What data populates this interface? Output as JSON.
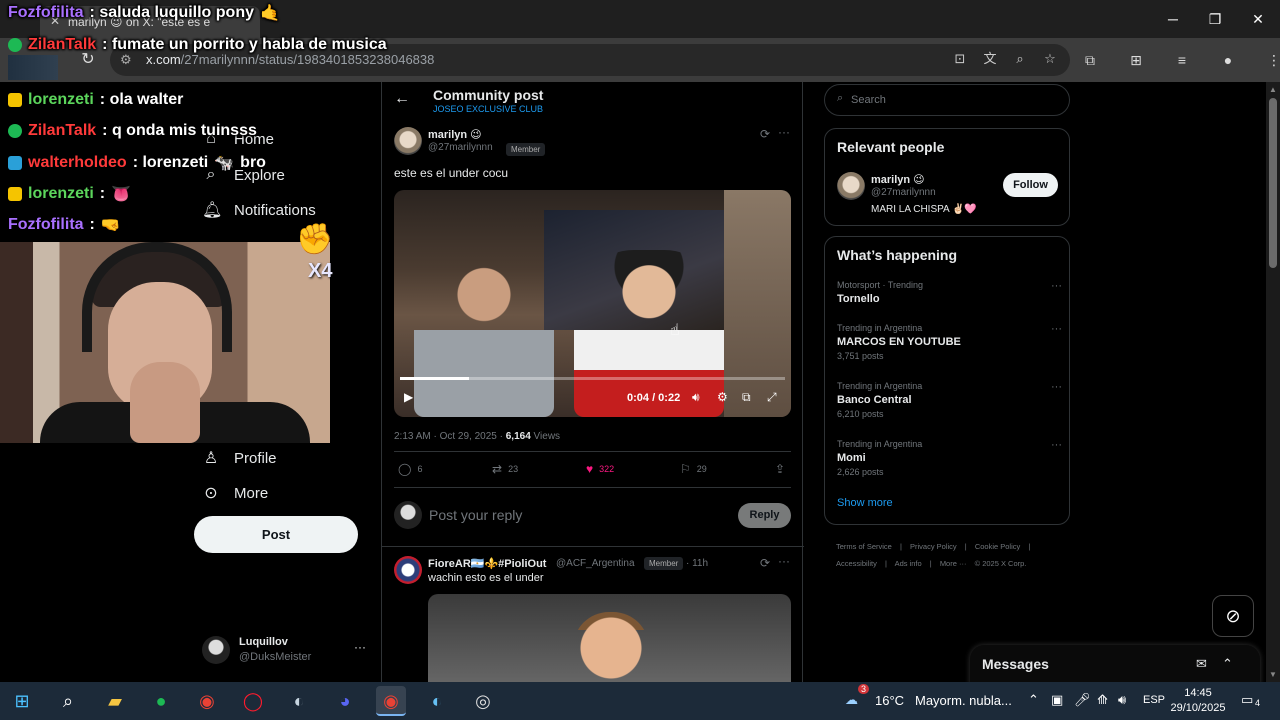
{
  "browser": {
    "tab_title": "marilyn 😉 on X: \"este es e",
    "url_host": "x.com",
    "url_path": "/27marilynnn/status/1983401853238046838",
    "window_controls": {
      "minimize": "─",
      "maximize": "❐",
      "close": "✕"
    }
  },
  "nav": {
    "items": [
      {
        "label": "Home",
        "icon": "⌂"
      },
      {
        "label": "Explore",
        "icon": "⌕"
      },
      {
        "label": "Notifications",
        "icon": "🔔"
      },
      {
        "label": "Profile",
        "icon": "👤"
      },
      {
        "label": "More",
        "icon": "⋯"
      }
    ],
    "post_label": "Post",
    "account": {
      "name": "Luquillov",
      "handle": "@DuksMeister",
      "more": "···"
    }
  },
  "header": {
    "title": "Community post",
    "subtitle": "JOSEO EXCLUSIVE CLUB"
  },
  "post": {
    "author_name": "marilyn 😉",
    "author_handle": "@27marilynnn",
    "member_badge": "Member",
    "text": "este es el under cocu",
    "video_time": "0:04 / 0:22",
    "video_progress": 0.18,
    "timestamp": "2:13 AM · Oct 29, 2025 · ",
    "views_count": "6,164",
    "views_label": " Views",
    "replies": "6",
    "reposts": "23",
    "likes": "322",
    "bookmarks": "29",
    "like_color": "#f91880"
  },
  "reply_box": {
    "placeholder": "Post your reply",
    "button": "Reply"
  },
  "second_post": {
    "author_name": "FioreAR🇦🇷⚜️#PioliOut",
    "author_handle": "@ACF_Argentina",
    "member_badge": "Member",
    "time": "· 11h",
    "text": "wachin esto es el under"
  },
  "sidebar": {
    "search_placeholder": "Search",
    "relevant_title": "Relevant people",
    "person_name": "marilyn 😉",
    "person_handle": "@27marilynnn",
    "person_bio": "MARI LA CHISPA ✌🏻🩷",
    "follow_label": "Follow",
    "happening_title": "What’s happening",
    "trends": [
      {
        "context": "Motorsport · Trending",
        "name": "Tornello",
        "count": ""
      },
      {
        "context": "Trending in Argentina",
        "name": "MARCOS EN YOUTUBE",
        "count": "3,751 posts"
      },
      {
        "context": "Trending in Argentina",
        "name": "Banco Central",
        "count": "6,210 posts"
      },
      {
        "context": "Trending in Argentina",
        "name": "Momi",
        "count": "2,626 posts"
      }
    ],
    "show_more": "Show more",
    "footer_links": [
      "Terms of Service",
      "|",
      "Privacy Policy",
      "|",
      "Cookie Policy",
      "|",
      "Accessibility",
      "|",
      "Ads info",
      "|",
      "More ···",
      "© 2025 X Corp."
    ]
  },
  "messages": {
    "title": "Messages"
  },
  "chat": [
    {
      "user": "Fozfofilita",
      "color": "#a970ff",
      "badge": "",
      "text": ": saluda luquillo pony",
      "emote": "🤙"
    },
    {
      "user": "ZilanTalk",
      "color": "#ff3a3a",
      "badge": "#1db954",
      "text": ": fumate un porrito y habla de musica",
      "emote": ""
    },
    {
      "user": "lorenzeti",
      "color": "#5cd65c",
      "badge": "#f5c400",
      "text": ": ola walter",
      "emote": "🐄"
    },
    {
      "user": "ZilanTalk",
      "color": "#ff3a3a",
      "badge": "#1db954",
      "text": ": q onda mis tuinsss",
      "emote": ""
    },
    {
      "user": "walterholdeo",
      "color": "#ff3a3a",
      "badge": "#2aa0d8",
      "text": ": lorenzeti",
      "emote": "🐄",
      "after": "bro"
    },
    {
      "user": "lorenzeti",
      "color": "#5cd65c",
      "badge": "#f5c400",
      "text": ":",
      "emote": "👅"
    },
    {
      "user": "Fozfofilita",
      "color": "#a970ff",
      "badge": "",
      "text": ":",
      "emote": "🤜"
    }
  ],
  "overlay": {
    "combo": "X4"
  },
  "taskbar": {
    "weather_temp": "16°C",
    "weather_text": "Mayorm. nubla...",
    "weather_badge": "3",
    "language": "ESP",
    "time": "14:45",
    "date": "29/10/2025",
    "notification_count": "4"
  }
}
